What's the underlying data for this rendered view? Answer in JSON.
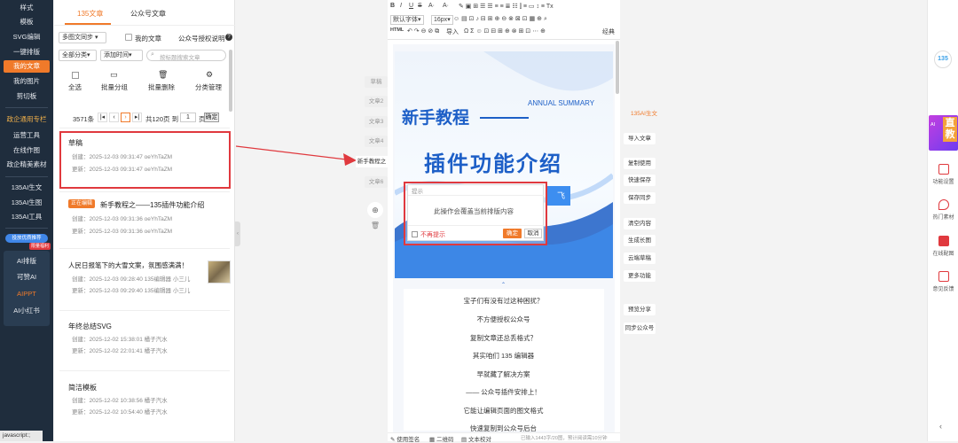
{
  "nav": {
    "items": [
      "样式",
      "模板",
      "SVG编辑",
      "一键排版",
      "我的文章",
      "我的图片",
      "剪切板",
      "政企通用专栏",
      "运营工具",
      "在线作图",
      "政企精美素材",
      "135AI生文",
      "135AI生图",
      "135AI工具"
    ],
    "special_badge": "限量福利",
    "pill": "投放优质推荐",
    "ai_items": [
      "AI排版",
      "可赞AI",
      "AIPPT",
      "AI小红书"
    ],
    "status": "javascript:;"
  },
  "left": {
    "tabs": [
      "135文章",
      "公众号文章"
    ],
    "sync_label": "多图文同步",
    "my_article": "我的文章",
    "auth_link": "公众号授权说明",
    "filter_all": "全部分类",
    "filter_time": "添加时间",
    "search_placeholder": "按标题搜索文章",
    "actions": [
      "全选",
      "批量分组",
      "批量删除",
      "分类管理"
    ],
    "pager": {
      "count": "3571条",
      "current": "1",
      "total_text": "共120页 到",
      "page_unit": "页",
      "confirm": "确定"
    },
    "articles": [
      {
        "title": "草稿",
        "created": "创建：2025-12-03 09:31:47  oeYhTaZM",
        "updated": "更新：2025-12-03 09:31:47  oeYhTaZM"
      },
      {
        "badge": "正在编辑",
        "title": "新手教程之——135插件功能介绍",
        "created": "创建：2025-12-03 09:31:36  oeYhTaZM",
        "updated": "更新：2025-12-03 09:31:36  oeYhTaZM"
      },
      {
        "title": "人民日报笔下的大雪文案，氛围感满满！",
        "created": "创建：2025-12-03 09:28:40  135编辑器 小三儿",
        "updated": "更新：2025-12-03 09:29:40  135编辑器 小三儿"
      },
      {
        "title": "年终总结SVG",
        "created": "创建：2025-12-02 15:38:01  橘子汽水",
        "updated": "更新：2025-12-02 22:01:41  橘子汽水"
      },
      {
        "title": "简洁模板",
        "created": "创建：2025-12-02 10:38:56  橘子汽水",
        "updated": "更新：2025-12-02 10:54:40  橘子汽水"
      }
    ]
  },
  "arrow_label": "新手教程之",
  "side_tabs": [
    "草稿",
    "文章2",
    "文章3",
    "文章4",
    "文章6"
  ],
  "toolbar": {
    "font": "默认字体",
    "size": "16px",
    "html": "HTML",
    "import": "导入",
    "classic": "经典"
  },
  "article": {
    "title": "新手教程",
    "annual": "ANNUAL SUMMARY",
    "subtitle": "插件功能介绍",
    "lines": [
      "宝子们有没有过这种困扰？",
      "不方便授权公众号",
      "复制文章还总丢格式？",
      "其实咱们 135 编辑器",
      "早就藏了解决方案",
      "—— 公众号插件安排上！",
      "它能让编辑页面的图文格式",
      "快速复制到公众号后台"
    ]
  },
  "dialog": {
    "title": "提示",
    "message": "此操作会覆盖当前排版内容",
    "checkbox": "不再提示",
    "confirm": "确定",
    "cancel": "取消",
    "fragment": "飞"
  },
  "editor_status": {
    "items": [
      "使用签名",
      "二维码",
      "文本校对"
    ],
    "count": "已输入1443字/20图，预计阅读需10分钟"
  },
  "side_buttons": [
    "135AI生文",
    "导入文章",
    "复制使用",
    "快速保存",
    "保存同步",
    "清空内容",
    "生成长图",
    "云端草稿",
    "更多功能",
    "预览分享",
    "同步公众号"
  ],
  "right": {
    "logo": "135",
    "promo_text": "直教",
    "promo_small": "AI",
    "items": [
      "功能设置",
      "热门素材",
      "在线配图",
      "意见反馈"
    ]
  },
  "colors": {
    "accent": "#f07a2a",
    "nav": "#1f2d3d",
    "highlight": "#e0393e",
    "blue": "#1d5fc7"
  }
}
